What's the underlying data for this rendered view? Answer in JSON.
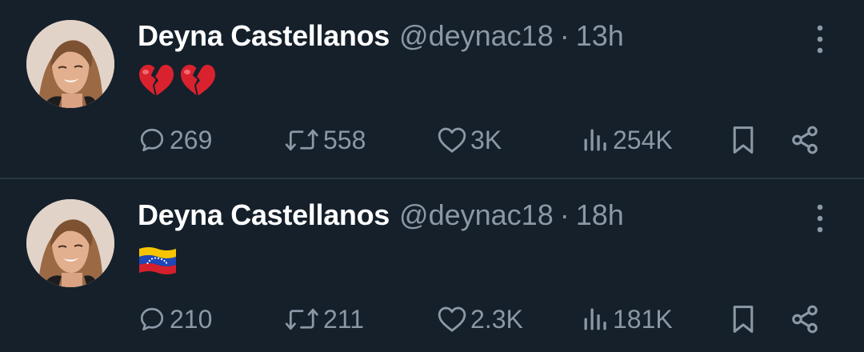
{
  "colors": {
    "background": "#15202b",
    "divider": "#2a3642",
    "name_text": "#ffffff",
    "secondary_text": "#8b98a5"
  },
  "tweets": [
    {
      "author": {
        "display_name": "Deyna Castellanos",
        "handle": "@deynac18",
        "avatar_icon": "profile-photo"
      },
      "separator": "·",
      "time": "13h",
      "content_emoji": [
        "broken-heart-icon",
        "broken-heart-icon"
      ],
      "actions": {
        "replies": "269",
        "retweets": "558",
        "likes": "3K",
        "views": "254K"
      }
    },
    {
      "author": {
        "display_name": "Deyna Castellanos",
        "handle": "@deynac18",
        "avatar_icon": "profile-photo"
      },
      "separator": "·",
      "time": "18h",
      "content_emoji": [
        "venezuela-flag-icon"
      ],
      "actions": {
        "replies": "210",
        "retweets": "211",
        "likes": "2.3K",
        "views": "181K"
      }
    }
  ]
}
